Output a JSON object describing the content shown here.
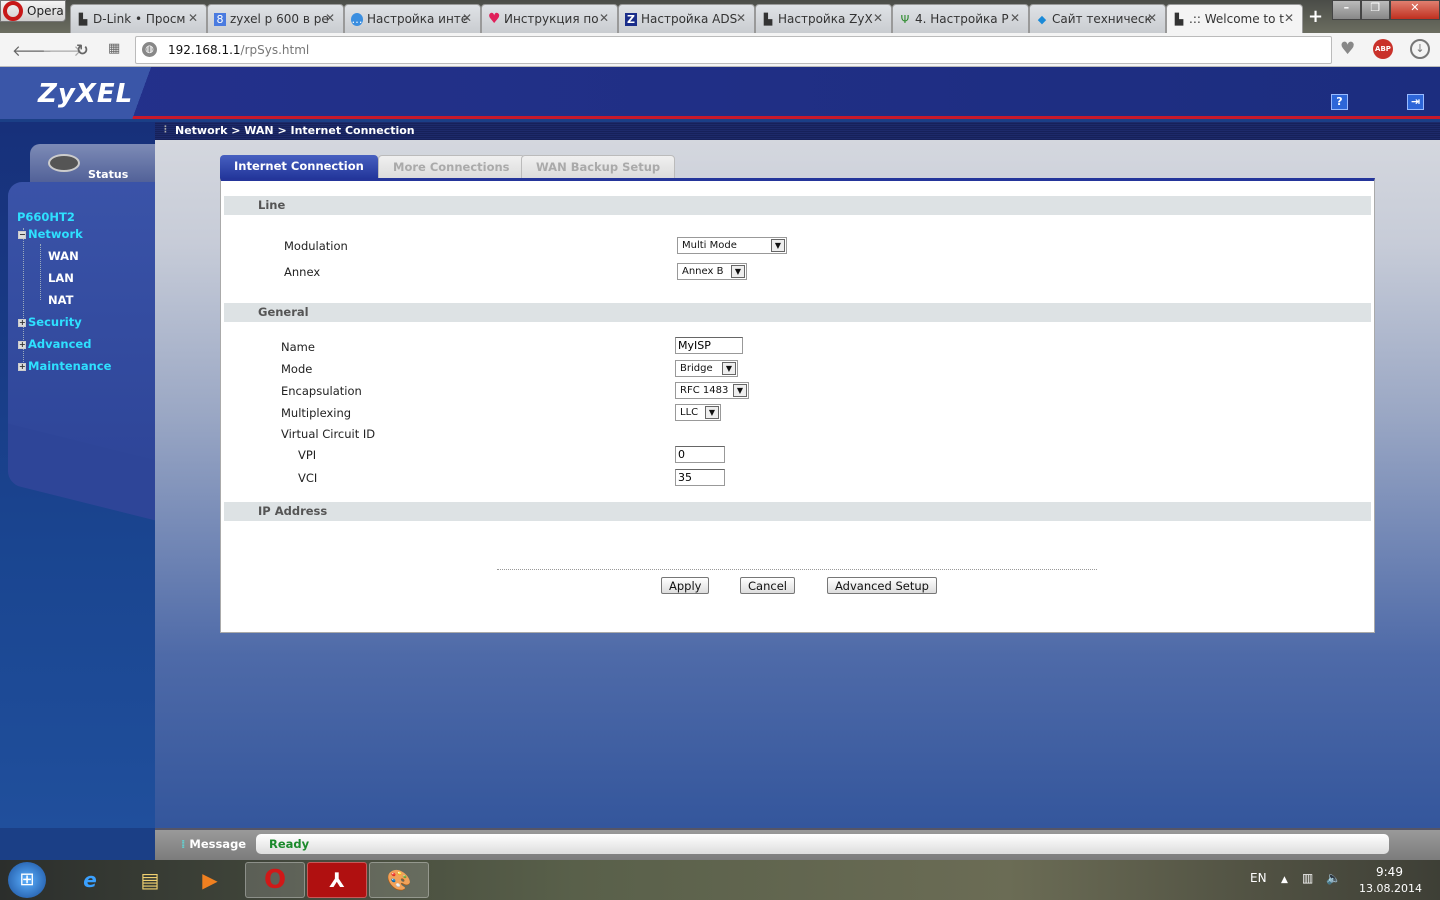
{
  "browser": {
    "menu_label": "Opera",
    "tabs": [
      {
        "title": "D-Link • Просм",
        "icon": "page-icon"
      },
      {
        "title": "zyxel p 600 в ре",
        "icon": "google-icon"
      },
      {
        "title": "Настройка инте",
        "icon": "chat-icon"
      },
      {
        "title": "Инструкция по",
        "icon": "heart-icon"
      },
      {
        "title": "Настройка ADS",
        "icon": "z-icon"
      },
      {
        "title": "Настройка ZyX",
        "icon": "page-icon"
      },
      {
        "title": "4. Настройка Р",
        "icon": "antenna-icon"
      },
      {
        "title": "Сайт техническ",
        "icon": "rostelecom-icon"
      },
      {
        "title": ".:: Welcome to t",
        "icon": "page-icon"
      }
    ],
    "url_host": "192.168.1.1",
    "url_path": "/rpSys.html"
  },
  "header": {
    "logo": "ZyXEL",
    "help": "?",
    "logout": "⇥"
  },
  "breadcrumb": "Network > WAN > Internet Connection",
  "sidebar": {
    "status": "Status",
    "device": "P660HT2",
    "items": [
      {
        "label": "Network",
        "expanded": true,
        "children": [
          "WAN",
          "LAN",
          "NAT"
        ]
      },
      {
        "label": "Security"
      },
      {
        "label": "Advanced"
      },
      {
        "label": "Maintenance"
      }
    ]
  },
  "tabs": [
    "Internet Connection",
    "More Connections",
    "WAN Backup Setup"
  ],
  "sections": {
    "line": "Line",
    "general": "General",
    "ip": "IP Address"
  },
  "line": {
    "modulation_label": "Modulation",
    "modulation": "Multi Mode",
    "annex_label": "Annex",
    "annex": "Annex B"
  },
  "general": {
    "name_label": "Name",
    "name": "MyISP",
    "mode_label": "Mode",
    "mode": "Bridge",
    "encap_label": "Encapsulation",
    "encap": "RFC 1483",
    "mux_label": "Multiplexing",
    "mux": "LLC",
    "vc_label": "Virtual Circuit ID",
    "vpi_label": "VPI",
    "vpi": "0",
    "vci_label": "VCI",
    "vci": "35"
  },
  "buttons": {
    "apply": "Apply",
    "cancel": "Cancel",
    "advanced": "Advanced Setup"
  },
  "message": {
    "label": "Message",
    "text": "Ready"
  },
  "taskbar": {
    "lang": "EN",
    "time": "9:49",
    "date": "13.08.2014"
  }
}
